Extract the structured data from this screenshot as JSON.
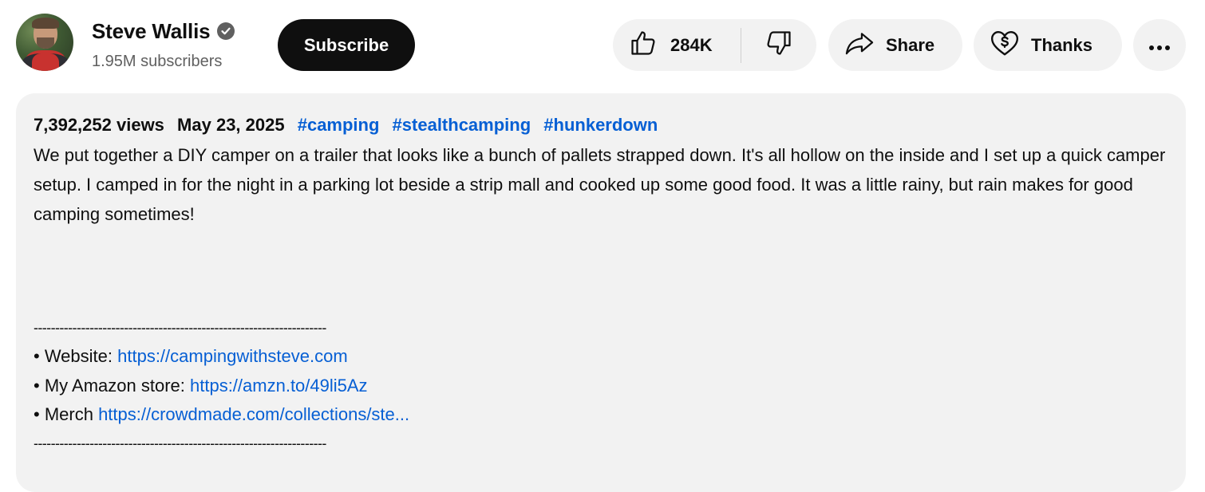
{
  "channel": {
    "name": "Steve Wallis",
    "subscribers": "1.95M subscribers",
    "verified_icon": "verified-check-icon"
  },
  "actions": {
    "subscribe_label": "Subscribe",
    "like_count": "284K",
    "share_label": "Share",
    "thanks_label": "Thanks",
    "icons": [
      "thumbs-up-icon",
      "thumbs-down-icon",
      "share-arrow-icon",
      "heart-dollar-icon",
      "more-icon"
    ]
  },
  "description": {
    "views": "7,392,252 views",
    "date": "May 23, 2025",
    "hashtags": [
      "#camping",
      "#stealthcamping",
      "#hunkerdown"
    ],
    "text": "We put together a DIY camper on a trailer that looks like a bunch of pallets strapped down. It's all hollow on the inside and I set up a quick camper setup. I camped in for the night in a parking lot beside a strip mall and cooked up some good food. It was a little rainy, but rain makes for good camping sometimes!",
    "separator": "--------------------------------------------------------------------",
    "links": [
      {
        "prefix": "• Website: ",
        "url": "https://campingwithsteve.com"
      },
      {
        "prefix": "• My Amazon store: ",
        "url": "https://amzn.to/49li5Az"
      },
      {
        "prefix": "• Merch ",
        "url": "https://crowdmade.com/collections/ste..."
      }
    ]
  },
  "colors": {
    "link": "#065fd4",
    "pill_bg": "#f2f2f2",
    "subscribe_bg": "#0f0f0f",
    "secondary_text": "#606060"
  }
}
